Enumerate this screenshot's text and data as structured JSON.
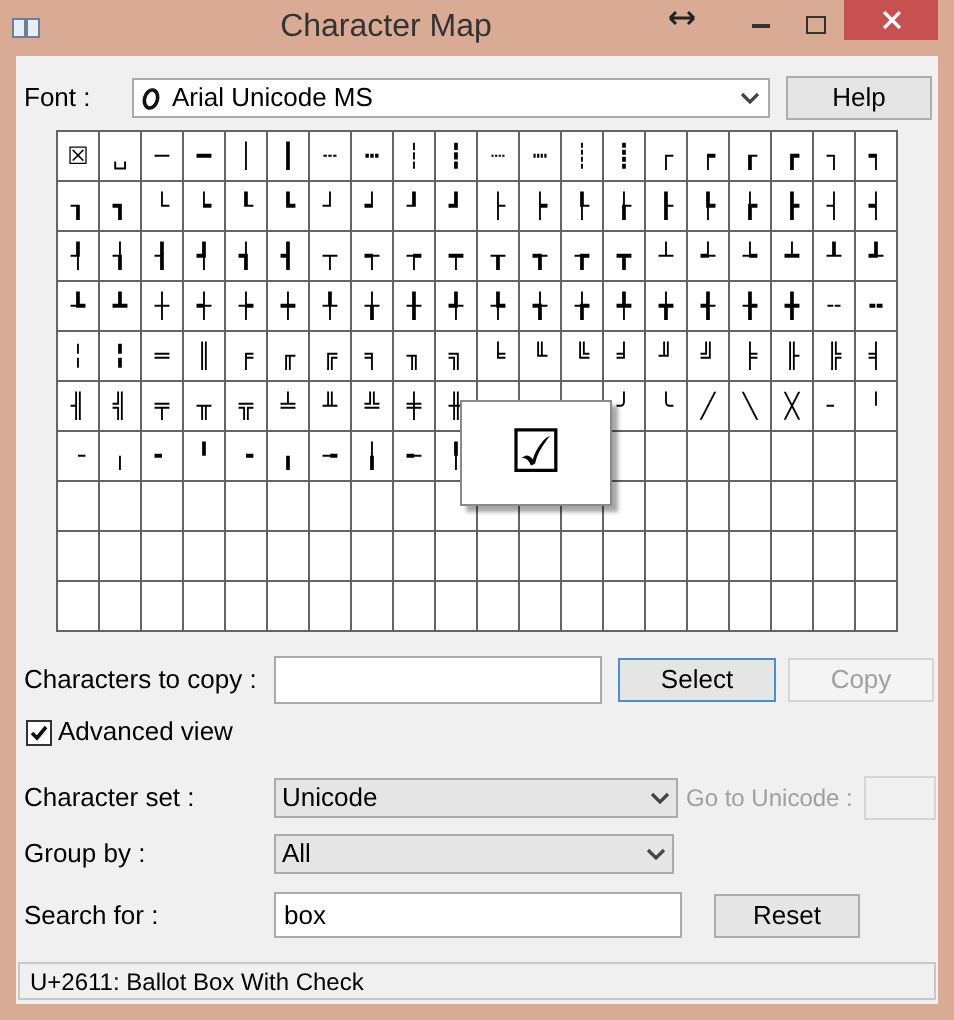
{
  "window": {
    "title": "Character Map"
  },
  "font": {
    "label": "Font :",
    "value": "Arial Unicode MS"
  },
  "help_button": "Help",
  "grid": {
    "rows": [
      [
        "☒",
        "␣",
        "─",
        "━",
        "│",
        "┃",
        "┄",
        "┅",
        "┆",
        "┇",
        "┈",
        "┉",
        "┊",
        "┋",
        "┌",
        "┍",
        "┎",
        "┏",
        "┐",
        "┑"
      ],
      [
        "┒",
        "┓",
        "└",
        "┕",
        "┖",
        "┗",
        "┘",
        "┙",
        "┚",
        "┛",
        "├",
        "┝",
        "┞",
        "┟",
        "┠",
        "┡",
        "┢",
        "┣",
        "┤",
        "┥"
      ],
      [
        "┦",
        "┧",
        "┨",
        "┩",
        "┪",
        "┫",
        "┬",
        "┭",
        "┮",
        "┯",
        "┰",
        "┱",
        "┲",
        "┳",
        "┴",
        "┵",
        "┶",
        "┷",
        "┸",
        "┹"
      ],
      [
        "┺",
        "┻",
        "┼",
        "┽",
        "┾",
        "┿",
        "╀",
        "╁",
        "╂",
        "╃",
        "╄",
        "╅",
        "╆",
        "╇",
        "╈",
        "╉",
        "╊",
        "╋",
        "╌",
        "╍"
      ],
      [
        "╎",
        "╏",
        "═",
        "║",
        "╒",
        "╓",
        "╔",
        "╕",
        "╖",
        "╗",
        "╘",
        "╙",
        "╚",
        "╛",
        "╜",
        "╝",
        "╞",
        "╟",
        "╠",
        "╡"
      ],
      [
        "╢",
        "╣",
        "╤",
        "╥",
        "╦",
        "╧",
        "╨",
        "╩",
        "╪",
        "╫",
        null,
        null,
        null,
        "╯",
        "╰",
        "╱",
        "╲",
        "╳",
        "╴",
        "╵"
      ],
      [
        "╶",
        "╷",
        "╸",
        "╹",
        "╺",
        "╻",
        "╼",
        "╽",
        "╾",
        "╿"
      ]
    ]
  },
  "popup": {
    "char": "☑"
  },
  "characters_to_copy": {
    "label": "Characters to copy :"
  },
  "select_button": {
    "label": "Select",
    "disabled": false
  },
  "copy_button": {
    "label": "Copy",
    "disabled": true
  },
  "advanced_view": {
    "label": "Advanced view",
    "checked": true
  },
  "character_set": {
    "label": "Character set :",
    "value": "Unicode"
  },
  "go_to_unicode": {
    "label": "Go to Unicode :",
    "disabled": true
  },
  "group_by": {
    "label": "Group by :",
    "value": "All"
  },
  "search": {
    "label": "Search for :",
    "value": "box"
  },
  "reset_button": {
    "label": "Reset",
    "disabled": false
  },
  "status_bar": "U+2611: Ballot Box With Check"
}
